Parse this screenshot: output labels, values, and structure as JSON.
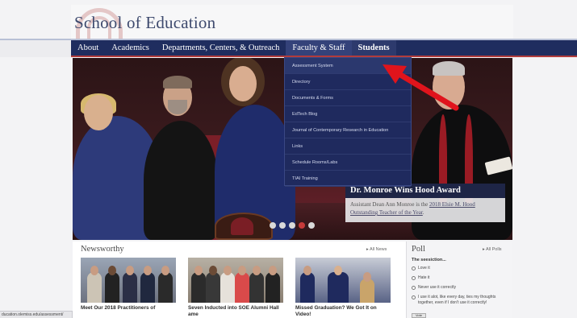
{
  "site": {
    "title": "School of Education"
  },
  "nav": {
    "items": [
      {
        "label": "About"
      },
      {
        "label": "Academics"
      },
      {
        "label": "Departments, Centers, & Outreach"
      },
      {
        "label": "Faculty & Staff"
      },
      {
        "label": "Students"
      }
    ]
  },
  "dropdown": {
    "items": [
      {
        "label": "Assessment System"
      },
      {
        "label": "Directory"
      },
      {
        "label": "Documents & Forms"
      },
      {
        "label": "EdTech Blog"
      },
      {
        "label": "Journal of Contemporary Research in Education"
      },
      {
        "label": "Links"
      },
      {
        "label": "Schedule Rooms/Labs"
      },
      {
        "label": "TIAI Training"
      }
    ]
  },
  "hero": {
    "caption_title": "Dr. Monroe Wins Hood Award",
    "caption_body_prefix": "Assistant Dean Ann Monroe is the ",
    "caption_link": "2018 Elsie M. Hood Outstanding Teacher of the Year",
    "caption_body_suffix": ".",
    "dots": {
      "count": 5,
      "active_index": 3
    }
  },
  "news": {
    "heading": "Newsworthy",
    "all_link": "All News",
    "items": [
      {
        "title": "Meet Our 2018 Practitioners of"
      },
      {
        "title": "Seven Inducted into SOE Alumni Hall ame"
      },
      {
        "title": "Missed Graduation? We Got It on Video!"
      }
    ]
  },
  "poll": {
    "heading": "Poll",
    "all_link": "All Polls",
    "question": "The seesiction...",
    "options": [
      {
        "label": "Love it"
      },
      {
        "label": "Hate it"
      },
      {
        "label": "Never use it correctly"
      },
      {
        "label": "I use it alot, like every day, ties my thoughts together, even if I don't use it correctly!"
      }
    ],
    "vote_label": "Vote"
  },
  "status_bar": {
    "url": "ducation.olemiss.edu/assessment/"
  },
  "colors": {
    "nav": "#1f2d5f",
    "accent": "#b23c3c",
    "annotation_arrow": "#e0141c"
  },
  "icons": {
    "arrow": "arrow-annotation-icon",
    "list_arrow": "chevron-right-icon"
  }
}
